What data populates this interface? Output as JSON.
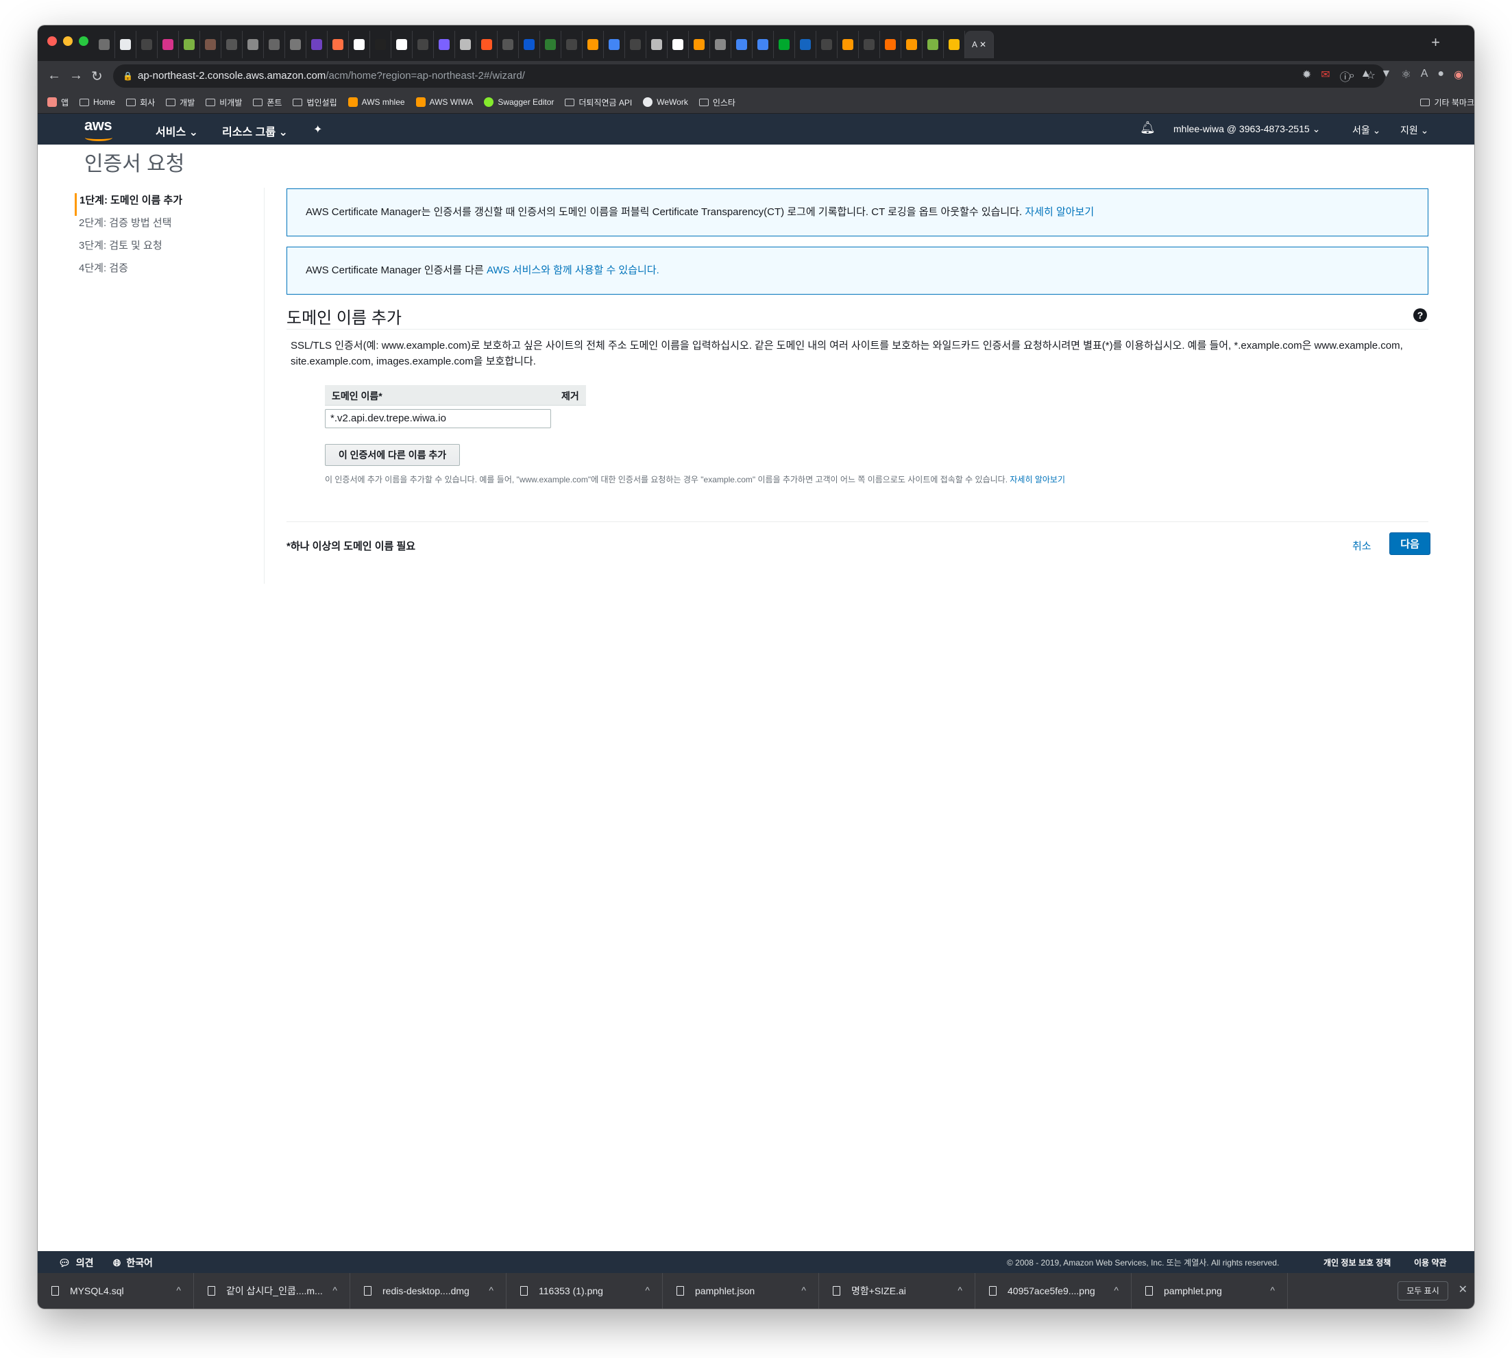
{
  "browser": {
    "tab_active_label": "A",
    "new_tab_label": "+",
    "url_host": "ap-northeast-2.console.aws.amazon.com",
    "url_path": "/acm/home?region=ap-northeast-2#/wizard/",
    "extension_badge": "15",
    "bookmarks": [
      {
        "label": "앱",
        "icon": "apps-grid-icon"
      },
      {
        "label": "Home",
        "icon": "folder-icon"
      },
      {
        "label": "회사",
        "icon": "folder-icon"
      },
      {
        "label": "개발",
        "icon": "folder-icon"
      },
      {
        "label": "비개발",
        "icon": "folder-icon"
      },
      {
        "label": "폰트",
        "icon": "folder-icon"
      },
      {
        "label": "법인설립",
        "icon": "folder-icon"
      },
      {
        "label": "AWS mhlee",
        "icon": "aws-cube-icon"
      },
      {
        "label": "AWS WIWA",
        "icon": "aws-cube-icon"
      },
      {
        "label": "Swagger Editor",
        "icon": "swagger-icon"
      },
      {
        "label": "더퇴직연금 API",
        "icon": "folder-icon"
      },
      {
        "label": "WeWork",
        "icon": "globe-icon"
      },
      {
        "label": "인스타",
        "icon": "folder-icon"
      }
    ],
    "bookmark_other": "기타 북마크"
  },
  "aws_header": {
    "logo_text": "aws",
    "services": "서비스",
    "resource_groups": "리소스 그룹",
    "account": "mhlee-wiwa @ 3963-4873-2515",
    "region": "서울",
    "support": "지원"
  },
  "page": {
    "title": "인증서 요청",
    "steps": [
      "1단계: 도메인 이름 추가",
      "2단계: 검증 방법 선택",
      "3단계: 검토 및 요청",
      "4단계: 검증"
    ],
    "info1_text": "AWS Certificate Manager는 인증서를 갱신할 때 인증서의 도메인 이름을 퍼블릭 Certificate Transparency(CT) 로그에 기록합니다. CT 로깅을 옵트 아웃할수 있습니다. ",
    "info1_link": "자세히 알아보기",
    "info2_text": "AWS Certificate Manager 인증서를 다른 ",
    "info2_link": "AWS 서비스와 함께 사용할 수 있습니다.",
    "section_title": "도메인 이름 추가",
    "help_icon": "?",
    "description": "SSL/TLS 인증서(예: www.example.com)로 보호하고 싶은 사이트의 전체 주소 도메인 이름을 입력하십시오. 같은 도메인 내의 여러 사이트를 보호하는 와일드카드 인증서를 요청하시려면 별표(*)를 이용하십시오. 예를 들어, *.example.com은 www.example.com, site.example.com, images.example.com을 보호합니다.",
    "col_domain": "도메인 이름*",
    "col_remove": "제거",
    "domain_value": "*.v2.api.dev.trepe.wiwa.io",
    "add_button": "이 인증서에 다른 이름 추가",
    "hint_text": "이 인증서에 추가 이름을 추가할 수 있습니다. 예를 들어, \"www.example.com\"에 대한 인증서를 요청하는 경우 \"example.com\" 이름을 추가하면 고객이 어느 쪽 이름으로도 사이트에 접속할 수 있습니다. ",
    "hint_link": "자세히 알아보기",
    "required_note": "*하나 이상의 도메인 이름 필요",
    "cancel": "취소",
    "next": "다음"
  },
  "footer": {
    "feedback": "의견",
    "language": "한국어",
    "copyright": "© 2008 - 2019, Amazon Web Services, Inc. 또는 계열사. All rights reserved.",
    "privacy": "개인 정보 보호 정책",
    "terms": "이용 약관"
  },
  "downloads": {
    "items": [
      "MYSQL4.sql",
      "같이 삽시다_인쿱....m...",
      "redis-desktop....dmg",
      "116353 (1).png",
      "pamphlet.json",
      "명함+SIZE.ai",
      "40957ace5fe9....png",
      "pamphlet.png"
    ],
    "show_all": "모두 표시"
  },
  "colors": {
    "aws_nav": "#232f3e",
    "aws_orange": "#ff9900",
    "link_blue": "#0073bb",
    "info_bg": "#f1faff"
  }
}
